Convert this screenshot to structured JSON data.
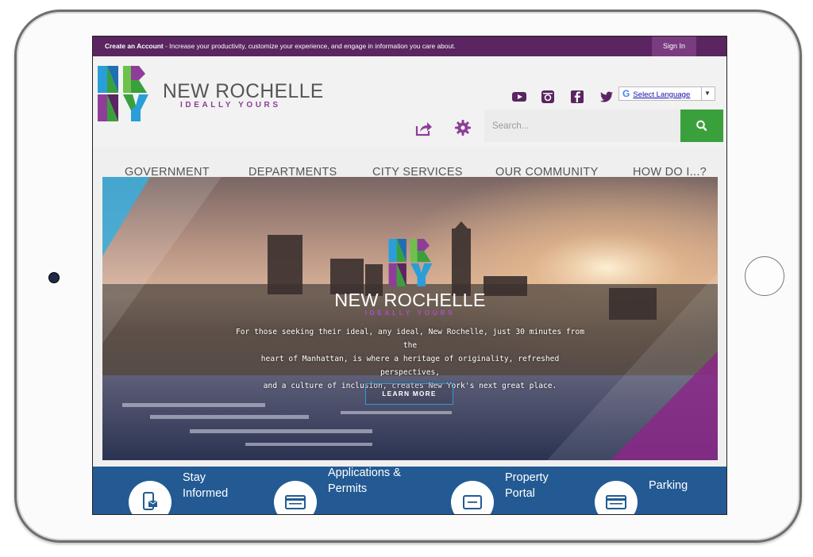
{
  "topbar": {
    "create_link": "Create an Account",
    "message": " - Increase your productivity, customize your experience, and engage in information you care about.",
    "signin": "Sign In"
  },
  "brand": {
    "name": "NEW ROCHELLE",
    "tagline": "IDEALLY YOURS"
  },
  "language": {
    "g": "G",
    "label": "Select Language",
    "arrow": "▼"
  },
  "search": {
    "placeholder": "Search..."
  },
  "nav": [
    "GOVERNMENT",
    "DEPARTMENTS",
    "CITY SERVICES",
    "OUR COMMUNITY",
    "HOW DO I...?"
  ],
  "hero": {
    "name": "NEW ROCHELLE",
    "tagline": "IDEALLY YOURS",
    "line1": "For those seeking their ideal, any ideal, New Rochelle, just 30 minutes from the",
    "line2": "heart of Manhattan, is where a heritage of originality, refreshed perspectives,",
    "line3": "and a culture of inclusion, creates New York's next great place.",
    "button": "LEARN MORE"
  },
  "quicklinks": [
    {
      "line1": "Stay",
      "line2": "Informed",
      "icon": "phone-envelope-icon"
    },
    {
      "line1": "Applications &",
      "line2": "Permits",
      "icon": "form-icon"
    },
    {
      "line1": "Property",
      "line2": "Portal",
      "icon": "document-icon"
    },
    {
      "line1": "Parking",
      "line2": "",
      "icon": "card-icon"
    }
  ],
  "colors": {
    "topbar": "#5a2560",
    "search_button": "#3aa03c",
    "quicklinks_bar": "#235a93",
    "brand_purple": "#8e3e99"
  }
}
